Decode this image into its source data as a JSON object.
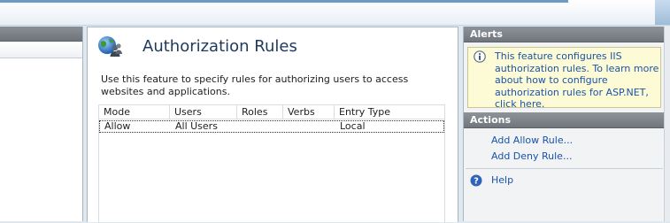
{
  "feature": {
    "title": "Authorization Rules",
    "description": "Use this feature to specify rules for authorizing users to access websites and applications.",
    "icon": "globe-with-users-icon"
  },
  "table": {
    "columns": [
      "Mode",
      "Users",
      "Roles",
      "Verbs",
      "Entry Type"
    ],
    "rows": [
      {
        "mode": "Allow",
        "users": "All Users",
        "roles": "",
        "verbs": "",
        "entry_type": "Local"
      }
    ]
  },
  "alerts": {
    "header": "Alerts",
    "icon": "info-icon",
    "text": "This feature configures IIS authorization rules. To learn more about how to configure authorization rules for ASP.NET, click here."
  },
  "actions": {
    "header": "Actions",
    "items": [
      "Add Allow Rule...",
      "Add Deny Rule..."
    ],
    "help": "Help",
    "help_icon": "help-icon"
  },
  "colors": {
    "accent": "#6f9cc6",
    "link": "#1a53a8",
    "title": "#1e395b",
    "alert_bg": "#fdfbd6"
  }
}
